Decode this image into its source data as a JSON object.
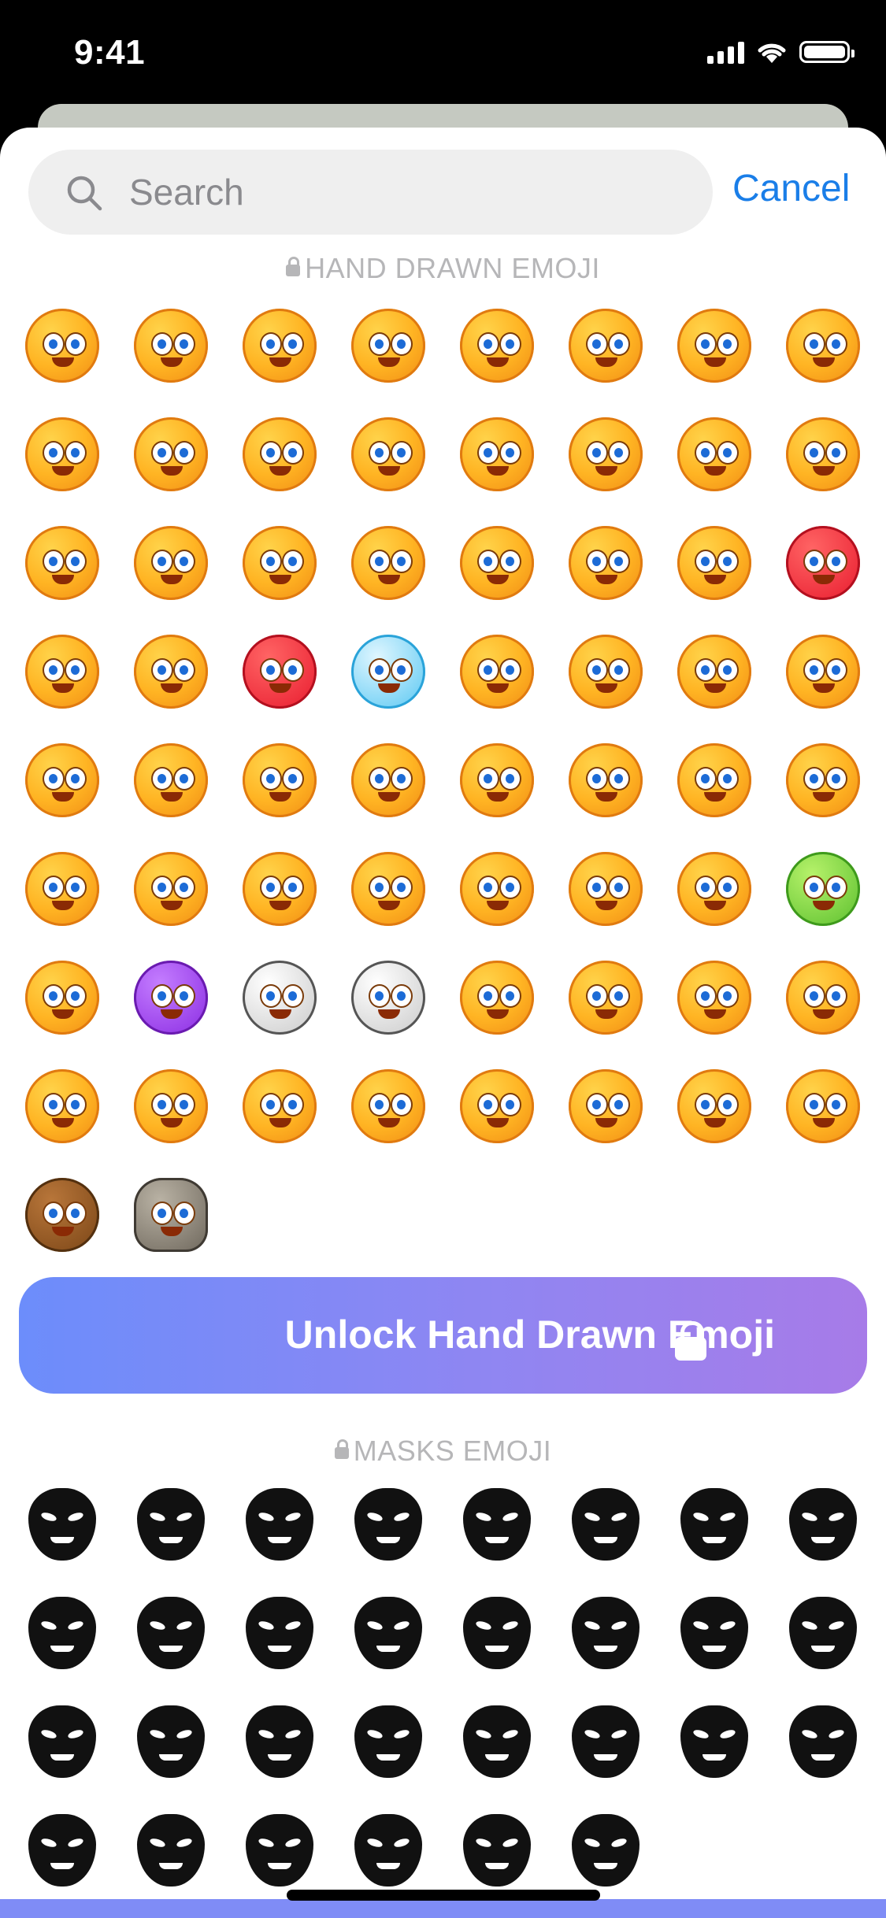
{
  "status_bar": {
    "time": "9:41"
  },
  "search": {
    "placeholder": "Search",
    "cancel_label": "Cancel"
  },
  "sections": {
    "hand_drawn": {
      "title": "HAND DRAWN EMOJI"
    },
    "masks": {
      "title": "MASKS EMOJI"
    }
  },
  "unlock_button": {
    "label": "Unlock Hand Drawn Emoji"
  },
  "hand_drawn_emoji": [
    "grinning-braces-emoji",
    "pleading-face-emoji",
    "sweat-smile-emoji",
    "laughing-emoji",
    "crying-emoji",
    "angel-emoji",
    "teary-eyes-emoji",
    "winking-emoji",
    "heart-eyes-emoji",
    "shy-waving-emoji",
    "tipsy-emoji",
    "crazy-face-emoji",
    "tongue-out-emoji",
    "kissing-hearts-emoji",
    "sad-puppy-emoji",
    "nerd-glasses-emoji",
    "sunglasses-emoji",
    "star-eyes-emoji",
    "party-emoji",
    "unamused-emoji",
    "cap-sunglasses-emoji",
    "sobbing-emoji",
    "steam-emoji",
    "angry-red-emoji",
    "mind-blown-emoji",
    "shocked-emoji",
    "sick-red-emoji",
    "frozen-emoji",
    "scream-emoji",
    "peeking-emoji",
    "thinking-emoji",
    "giggle-emoji",
    "salute-emoji",
    "melting-emoji",
    "pinocchio-emoji",
    "neutral-emoji",
    "expressionless-emoji",
    "surprised-emoji",
    "grimace-emoji",
    "pouting-emoji",
    "wide-eyes-emoji",
    "yawning-emoji",
    "sleepy-emoji",
    "drooling-emoji",
    "dizzy-emoji",
    "zipper-mouth-emoji",
    "unimpressed-emoji",
    "nauseous-emoji",
    "money-emoji",
    "devil-emoji",
    "clown-emoji",
    "skull-emoji",
    "thumbs-up-emoji",
    "thumbs-down-emoji",
    "ok-hand-emoji",
    "raised-hand-emoji",
    "facepalm-emoji",
    "hand-over-mouth-emoji",
    "laptop-emoji",
    "no-entry-emoji",
    "burger-yawn-emoji",
    "flamingo-float-emoji",
    "plus-one-emoji",
    "vomiting-emoji",
    "poop-emoji",
    "moai-emoji"
  ],
  "masks_emoji": [
    "guy-fawkes-mask-icon",
    "blank-mask-icon",
    "bat-mask-icon",
    "demon-mask-icon",
    "jester-mask-icon",
    "noface-mask-icon",
    "tribal-mask-icon",
    "grin-mask-icon",
    "plague-doctor-icon",
    "gas-mask-icon",
    "pumpkin-mask-icon",
    "diver-helmet-icon",
    "robot-visor-icon",
    "kitsune-mask-icon",
    "noh-mask-icon",
    "cyclops-mask-icon",
    "cat-visor-mask-icon",
    "hooded-mask-icon",
    "jigsaw-mask-icon",
    "smirk-mask-icon",
    "happy-mask-icon",
    "hood-mask-icon",
    "samurai-mask-icon",
    "balaclava-icon",
    "three-eyes-mask-icon",
    "helmet-mask-icon",
    "cube-face-icon",
    "robot-face-icon",
    "crown-mask-icon",
    "fedora-mask-icon"
  ]
}
